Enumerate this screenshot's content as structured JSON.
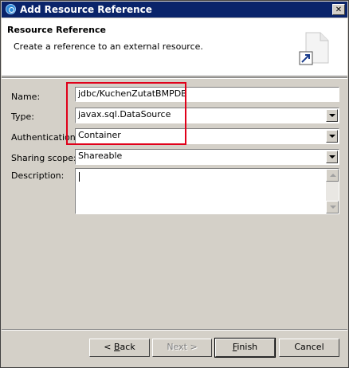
{
  "window": {
    "title": "Add Resource Reference",
    "close_glyph": "✕"
  },
  "banner": {
    "title": "Resource Reference",
    "description": "Create a reference to an external resource.",
    "icon": "resource-reference-wizard-icon"
  },
  "form": {
    "name": {
      "label": "Name:",
      "value": "jdbc/KuchenZutatBMPDB"
    },
    "type": {
      "label": "Type:",
      "value": "javax.sql.DataSource"
    },
    "authentication": {
      "label": "Authentication:",
      "value": "Container"
    },
    "sharing_scope": {
      "label": "Sharing scope:",
      "value": "Shareable"
    },
    "description": {
      "label": "Description:",
      "value": ""
    }
  },
  "buttons": {
    "back": {
      "prefix": "< ",
      "mnemonic": "B",
      "rest": "ack"
    },
    "next": {
      "text": "Next >"
    },
    "finish": {
      "mnemonic": "F",
      "rest": "inish"
    },
    "cancel": {
      "text": "Cancel"
    }
  },
  "colors": {
    "titlebar": "#0a246a",
    "highlight": "#e0001a",
    "dialog_bg": "#d4d0c8"
  }
}
